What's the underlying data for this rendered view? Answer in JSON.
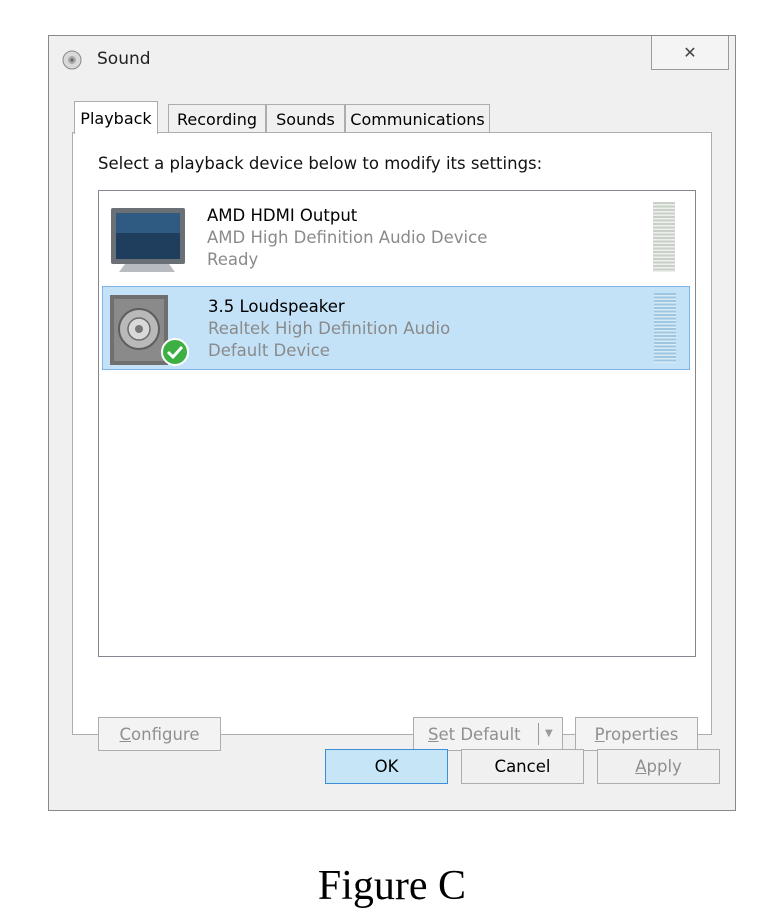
{
  "window": {
    "title": "Sound",
    "close_glyph": "✕"
  },
  "tabs": [
    {
      "label": "Playback",
      "active": true
    },
    {
      "label": "Recording",
      "active": false
    },
    {
      "label": "Sounds",
      "active": false
    },
    {
      "label": "Communications",
      "active": false
    }
  ],
  "instruction": "Select a playback device below to modify its settings:",
  "devices": [
    {
      "name": "AMD HDMI Output",
      "description": "AMD High Definition Audio Device",
      "status": "Ready",
      "icon": "monitor-icon",
      "selected": false
    },
    {
      "name": "3.5 Loudspeaker",
      "description": "Realtek High Definition Audio",
      "status": "Default Device",
      "icon": "speaker-icon",
      "selected": true
    }
  ],
  "buttons": {
    "configure_prefix": "C",
    "configure_rest": "onfigure",
    "set_default_prefix": "S",
    "set_default_rest": "et Default",
    "properties_prefix": "P",
    "properties_rest": "roperties"
  },
  "footer": {
    "ok": "OK",
    "cancel": "Cancel",
    "apply_prefix": "A",
    "apply_rest": "pply"
  },
  "caption": "Figure C",
  "colors": {
    "selection_bg": "#c4e2f7",
    "default_check": "#3cb043",
    "ok_highlight": "#c6e6f7"
  }
}
